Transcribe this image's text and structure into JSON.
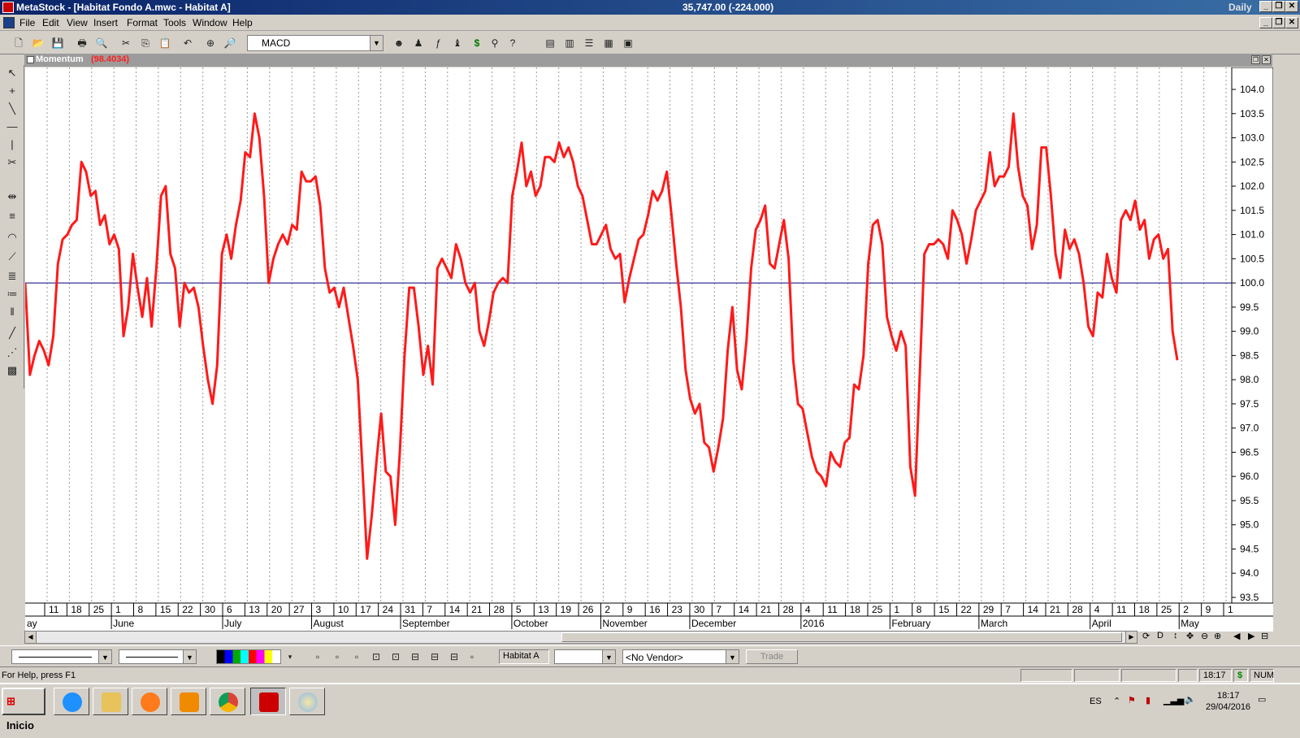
{
  "window": {
    "title": "MetaStock - [Habitat Fondo A.mwc - Habitat A]",
    "center_value": "35,747.00 (-224.000)",
    "periodicity": "Daily"
  },
  "menu": [
    "File",
    "Edit",
    "View",
    "Insert",
    "Format",
    "Tools",
    "Window",
    "Help"
  ],
  "toolbar": {
    "indicator_combo": "MACD"
  },
  "chart": {
    "indicator_name": "Momentum",
    "indicator_value": "(98.4034)",
    "line_color": "#ff1a1a",
    "reference_line_color": "#000080"
  },
  "chart_data": {
    "type": "line",
    "y_ticks": [
      "104.0",
      "103.5",
      "103.0",
      "102.5",
      "102.0",
      "101.5",
      "101.0",
      "100.5",
      "100.0",
      "99.5",
      "99.0",
      "98.5",
      "98.0",
      "97.5",
      "97.0",
      "96.5",
      "96.0",
      "95.5",
      "95.0",
      "94.5",
      "94.0",
      "93.5"
    ],
    "ylim": [
      93.5,
      104.0
    ],
    "reference_level": 100.0,
    "x_day_labels": [
      "11",
      "18",
      "25",
      "1",
      "8",
      "15",
      "22",
      "30",
      "6",
      "13",
      "20",
      "27",
      "3",
      "10",
      "17",
      "24",
      "31",
      "7",
      "14",
      "21",
      "28",
      "5",
      "13",
      "19",
      "26",
      "2",
      "9",
      "16",
      "23",
      "30",
      "7",
      "14",
      "21",
      "28",
      "4",
      "11",
      "18",
      "25",
      "1",
      "8",
      "15",
      "22",
      "29",
      "7",
      "14",
      "21",
      "28",
      "4",
      "11",
      "18",
      "25",
      "2",
      "9",
      "1"
    ],
    "x_month_labels": [
      "ay",
      "June",
      "July",
      "August",
      "September",
      "October",
      "November",
      "December",
      "2016",
      "February",
      "March",
      "April",
      "May"
    ],
    "series": [
      {
        "values": [
          100.0,
          98.1,
          98.5,
          98.8,
          98.6,
          98.3,
          98.9,
          100.4,
          100.9,
          101.0,
          101.2,
          101.3,
          102.5,
          102.3,
          101.8,
          101.9,
          101.2,
          101.4,
          100.8,
          101.0,
          100.7,
          98.9,
          99.5,
          100.6,
          99.9,
          99.3,
          100.1,
          99.1,
          100.3,
          101.8,
          102.0,
          100.6,
          100.3,
          99.1,
          100.0,
          99.8,
          99.9,
          99.5,
          98.7,
          98.0,
          97.5,
          98.3,
          100.6,
          101.0,
          100.5,
          101.2,
          101.7,
          102.7,
          102.6,
          103.5,
          103.0,
          101.8,
          100.0,
          100.5,
          100.8,
          101.0,
          100.8,
          101.2,
          101.1,
          102.3,
          102.1,
          102.1,
          102.2,
          101.6,
          100.3,
          99.8,
          99.9,
          99.5,
          99.9,
          99.3,
          98.7,
          98.0,
          96.2,
          94.3,
          95.2,
          96.3,
          97.3,
          96.1,
          96.0,
          95.0,
          96.5,
          98.5,
          99.9,
          99.9,
          99.1,
          98.1,
          98.7,
          97.9,
          100.3,
          100.5,
          100.3,
          100.1,
          100.8,
          100.5,
          100.0,
          99.8,
          100.0,
          99.0,
          98.7,
          99.2,
          99.8,
          100.0,
          100.1,
          100.0,
          101.8,
          102.3,
          102.9,
          102.0,
          102.3,
          101.8,
          102.0,
          102.6,
          102.6,
          102.5,
          102.9,
          102.6,
          102.8,
          102.5,
          102.0,
          101.8,
          101.3,
          100.8,
          100.8,
          101.0,
          101.2,
          100.7,
          100.5,
          100.6,
          99.6,
          100.1,
          100.5,
          100.9,
          101.0,
          101.4,
          101.9,
          101.7,
          101.9,
          102.3,
          101.4,
          100.4,
          99.5,
          98.2,
          97.6,
          97.3,
          97.5,
          96.7,
          96.6,
          96.1,
          96.6,
          97.2,
          98.6,
          99.5,
          98.2,
          97.8,
          98.8,
          100.3,
          101.1,
          101.3,
          101.6,
          100.4,
          100.3,
          100.8,
          101.3,
          100.5,
          98.4,
          97.5,
          97.4,
          96.9,
          96.4,
          96.1,
          96.0,
          95.8,
          96.5,
          96.3,
          96.2,
          96.7,
          96.8,
          97.9,
          97.8,
          98.5,
          100.4,
          101.2,
          101.3,
          100.8,
          99.3,
          98.9,
          98.6,
          99.0,
          98.7,
          96.2,
          95.6,
          98.1,
          100.6,
          100.8,
          100.8,
          100.9,
          100.8,
          100.5,
          101.5,
          101.3,
          101.0,
          100.4,
          100.9,
          101.5,
          101.7,
          101.9,
          102.7,
          102.0,
          102.2,
          102.2,
          102.4,
          103.5,
          102.4,
          101.8,
          101.6,
          100.7,
          101.2,
          102.8,
          102.8,
          101.8,
          100.6,
          100.1,
          101.1,
          100.7,
          100.9,
          100.6,
          100.0,
          99.1,
          98.9,
          99.8,
          99.7,
          100.6,
          100.1,
          99.8,
          101.3,
          101.5,
          101.3,
          101.7,
          101.1,
          101.3,
          100.5,
          100.9,
          101.0,
          100.5,
          100.7,
          99.0,
          98.4
        ]
      }
    ]
  },
  "bottombar": {
    "security": "Habitat A",
    "vendor": "<No Vendor>",
    "trade": "Trade"
  },
  "status": {
    "help": "For Help, press F1",
    "time": "18:17",
    "num": "NUM"
  },
  "taskbar": {
    "start": "Inicio",
    "lang": "ES",
    "time": "18:17",
    "date": "29/04/2016"
  }
}
